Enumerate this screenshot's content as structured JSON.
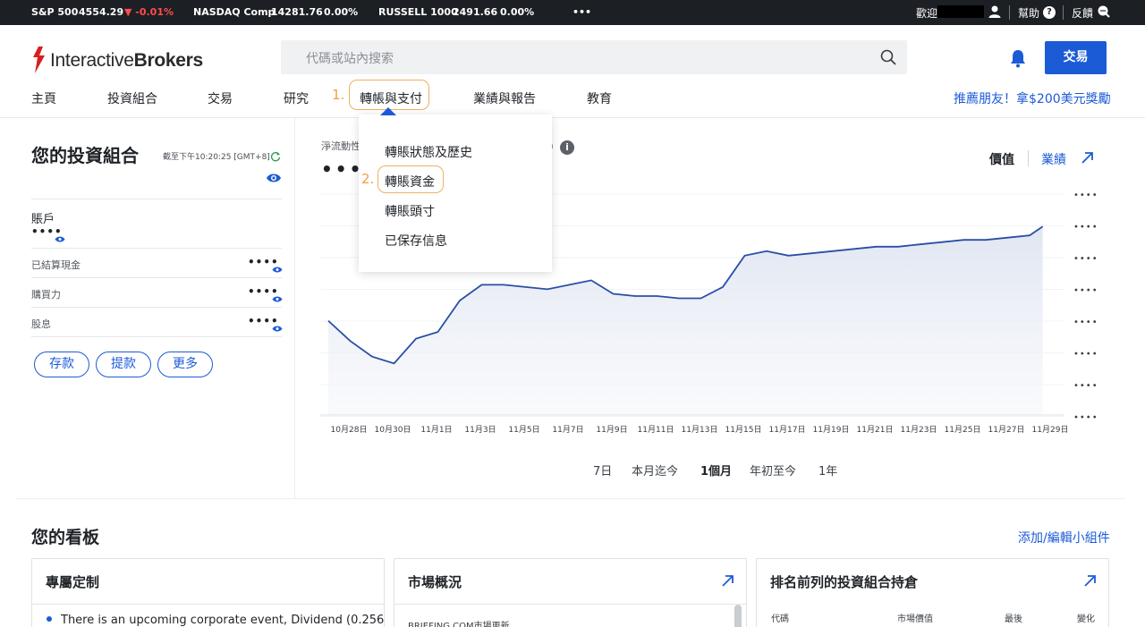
{
  "ticker": {
    "items": [
      {
        "name": "S&P 500",
        "value": "4554.29",
        "change": "▼ -0.01%"
      },
      {
        "name": "NASDAQ Comp",
        "value": "14281.76",
        "change": "0.00%"
      },
      {
        "name": "RUSSELL 1000",
        "value": "2491.66",
        "change": "0.00%"
      }
    ],
    "more": "•••",
    "welcome": "歡迎",
    "help": "幫助",
    "feedback": "反饋"
  },
  "header": {
    "logo_light": "Interactive",
    "logo_bold": "Brokers",
    "search_placeholder": "代碼或站內搜索",
    "trade_button": "交易"
  },
  "nav": {
    "items": [
      "主頁",
      "投資組合",
      "交易",
      "研究",
      "轉帳與支付",
      "業績與報告",
      "教育"
    ],
    "step1": "1.",
    "step2": "2.",
    "refer": "推薦朋友！拿$200美元獎勵"
  },
  "dropdown": {
    "items": [
      "轉賬狀態及歷史",
      "轉賬資金",
      "轉賬頭寸",
      "已保存信息"
    ]
  },
  "portfolio": {
    "title": "您的投資組合",
    "timestamp": "截至下午10:20:25 [GMT+8]",
    "account_label": "賬戶",
    "masked": "••••",
    "rows": [
      {
        "label": "已結算現金",
        "value": "••••"
      },
      {
        "label": "購買力",
        "value": "••••"
      },
      {
        "label": "股息",
        "value": "••••"
      }
    ],
    "buttons": [
      "存款",
      "提款",
      "更多"
    ]
  },
  "chart_panel": {
    "label": "淨流動性",
    "label_suffix": "t)",
    "value_masked": "•••",
    "toggle_value": "價值",
    "toggle_perf": "業績",
    "y_tick_masked": "••••",
    "ranges": [
      "7日",
      "本月迄今",
      "1個月",
      "年初至今",
      "1年"
    ],
    "active_range": "1個月"
  },
  "chart_data": {
    "type": "area",
    "x_labels": [
      "10月28日",
      "10月30日",
      "11月1日",
      "11月3日",
      "11月5日",
      "11月7日",
      "11月9日",
      "11月11日",
      "11月13日",
      "11月15日",
      "11月17日",
      "11月19日",
      "11月21日",
      "11月23日",
      "11月25日",
      "11月27日",
      "11月29日"
    ],
    "series": [
      {
        "x": [
          0,
          0.5,
          1,
          1.5,
          2,
          2.5,
          3,
          3.5,
          4,
          4.5,
          5,
          5.5,
          6,
          6.5,
          7,
          7.5,
          8,
          8.5,
          9,
          9.5,
          10,
          10.5,
          11,
          11.5,
          12,
          12.5,
          13,
          13.5,
          14,
          14.5,
          15,
          15.5,
          16,
          16.3
        ],
        "y": [
          42,
          33,
          26,
          23,
          34,
          37,
          51,
          58,
          58,
          57,
          56,
          58,
          60,
          54,
          53,
          53,
          52,
          52,
          57,
          71,
          73,
          71,
          72,
          73,
          74,
          75,
          75,
          76,
          77,
          78,
          78,
          79,
          80,
          84
        ]
      }
    ],
    "ylim": [
      0,
      100
    ],
    "y_unit_masked": true
  },
  "dashboard": {
    "title": "您的看板",
    "edit_link": "添加/編輯小組件",
    "cards": [
      {
        "title": "專屬定制",
        "text": "There is an upcoming corporate event, Dividend (0.256"
      },
      {
        "title": "市場概況",
        "text": "BRIEFING.COM市場更新"
      },
      {
        "title": "排名前列的投資組合持倉",
        "columns": [
          "代碼",
          "市場價值",
          "最後",
          "變化"
        ]
      }
    ]
  },
  "colors": {
    "accent": "#1c5bd6",
    "highlight": "#f0a040",
    "negative": "#ff4d4d",
    "ticker_bg": "#1c1f24"
  }
}
